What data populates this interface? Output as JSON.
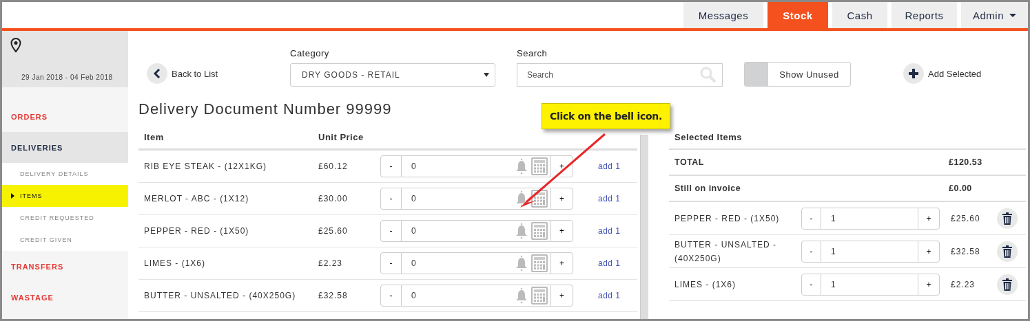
{
  "nav": [
    {
      "label": "Messages",
      "selected": false,
      "has_menu": false
    },
    {
      "label": "Stock",
      "selected": true,
      "has_menu": false
    },
    {
      "label": "Cash",
      "selected": false,
      "has_menu": false
    },
    {
      "label": "Reports",
      "selected": false,
      "has_menu": false
    },
    {
      "label": "Admin",
      "selected": false,
      "has_menu": true
    }
  ],
  "sidebar": {
    "date_range": "29 Jan 2018 - 04 Feb 2018",
    "sections": [
      {
        "label": "ORDERS",
        "expanded": false
      },
      {
        "label": "DELIVERIES",
        "expanded": true,
        "children": [
          {
            "label": "DELIVERY DETAILS",
            "selected": false
          },
          {
            "label": "ITEMS",
            "selected": true
          },
          {
            "label": "CREDIT REQUESTED",
            "selected": false
          },
          {
            "label": "CREDIT GIVEN",
            "selected": false
          }
        ]
      },
      {
        "label": "TRANSFERS",
        "expanded": false
      },
      {
        "label": "WASTAGE",
        "expanded": false
      }
    ]
  },
  "toolbar": {
    "back_label": "Back to List",
    "category": {
      "label": "Category",
      "value": "DRY GOODS - RETAIL"
    },
    "search": {
      "label": "Search",
      "placeholder": "Search"
    },
    "show_unused": {
      "label": "Show Unused",
      "on": false
    },
    "add_selected": "Add Selected"
  },
  "title": "Delivery Document Number 99999",
  "items_table": {
    "columns": [
      "Item",
      "Unit Price"
    ],
    "rows": [
      {
        "name": "RIB EYE STEAK - (12X1KG)",
        "price": "£60.12",
        "minus": "-",
        "quantity": "0",
        "plus": "+",
        "action": "add 1"
      },
      {
        "name": "MERLOT - ABC - (1X12)",
        "price": "£30.00",
        "minus": "-",
        "quantity": "0",
        "plus": "+",
        "action": "add 1"
      },
      {
        "name": "PEPPER - RED - (1X50)",
        "price": "£25.60",
        "minus": "-",
        "quantity": "0",
        "plus": "+",
        "action": "add 1"
      },
      {
        "name": "LIMES - (1X6)",
        "price": "£2.23",
        "minus": "-",
        "quantity": "0",
        "plus": "+",
        "action": "add 1"
      },
      {
        "name": "BUTTER - UNSALTED - (40X250G)",
        "price": "£32.58",
        "minus": "-",
        "quantity": "0",
        "plus": "+",
        "action": "add 1"
      }
    ]
  },
  "selected_items": {
    "title": "Selected Items",
    "totals": [
      {
        "label": "TOTAL",
        "value": "£120.53"
      },
      {
        "label": "Still on invoice",
        "value": "£0.00"
      }
    ],
    "rows": [
      {
        "name": "PEPPER - RED - (1X50)",
        "minus": "-",
        "quantity": "1",
        "plus": "+",
        "price": "£25.60"
      },
      {
        "name": "BUTTER - UNSALTED - (40X250G)",
        "minus": "-",
        "quantity": "1",
        "plus": "+",
        "price": "£32.58"
      },
      {
        "name": "LIMES - (1X6)",
        "minus": "-",
        "quantity": "1",
        "plus": "+",
        "price": "£2.23"
      }
    ]
  },
  "callout": {
    "text": "Click on the bell icon."
  }
}
